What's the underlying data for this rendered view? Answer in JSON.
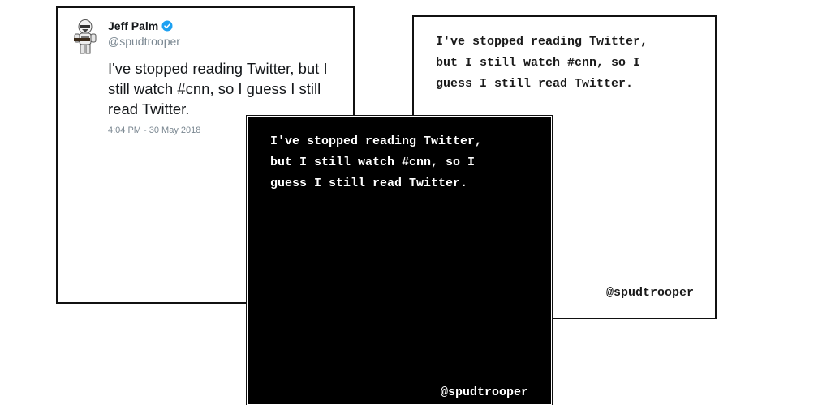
{
  "tweet": {
    "author_name": "Jeff Palm",
    "handle": "@spudtrooper",
    "text": "I've stopped reading Twitter, but I still watch #cnn, so I guess I still read Twitter.",
    "timestamp": "4:04 PM - 30 May 2018",
    "avatar_icon": "stormtrooper-avatar-icon",
    "verified_icon": "verified-badge-icon",
    "verified_color": "#1da1f2"
  },
  "white_card": {
    "quote": "I've stopped reading Twitter,\nbut I still watch #cnn, so I\nguess I still read Twitter.",
    "handle": "@spudtrooper",
    "background": "#ffffff",
    "text_color": "#1a1a1a"
  },
  "black_card": {
    "quote": "I've stopped reading Twitter,\nbut I still watch #cnn, so I\nguess I still read Twitter.",
    "handle": "@spudtrooper",
    "background": "#000000",
    "text_color": "#ffffff"
  }
}
